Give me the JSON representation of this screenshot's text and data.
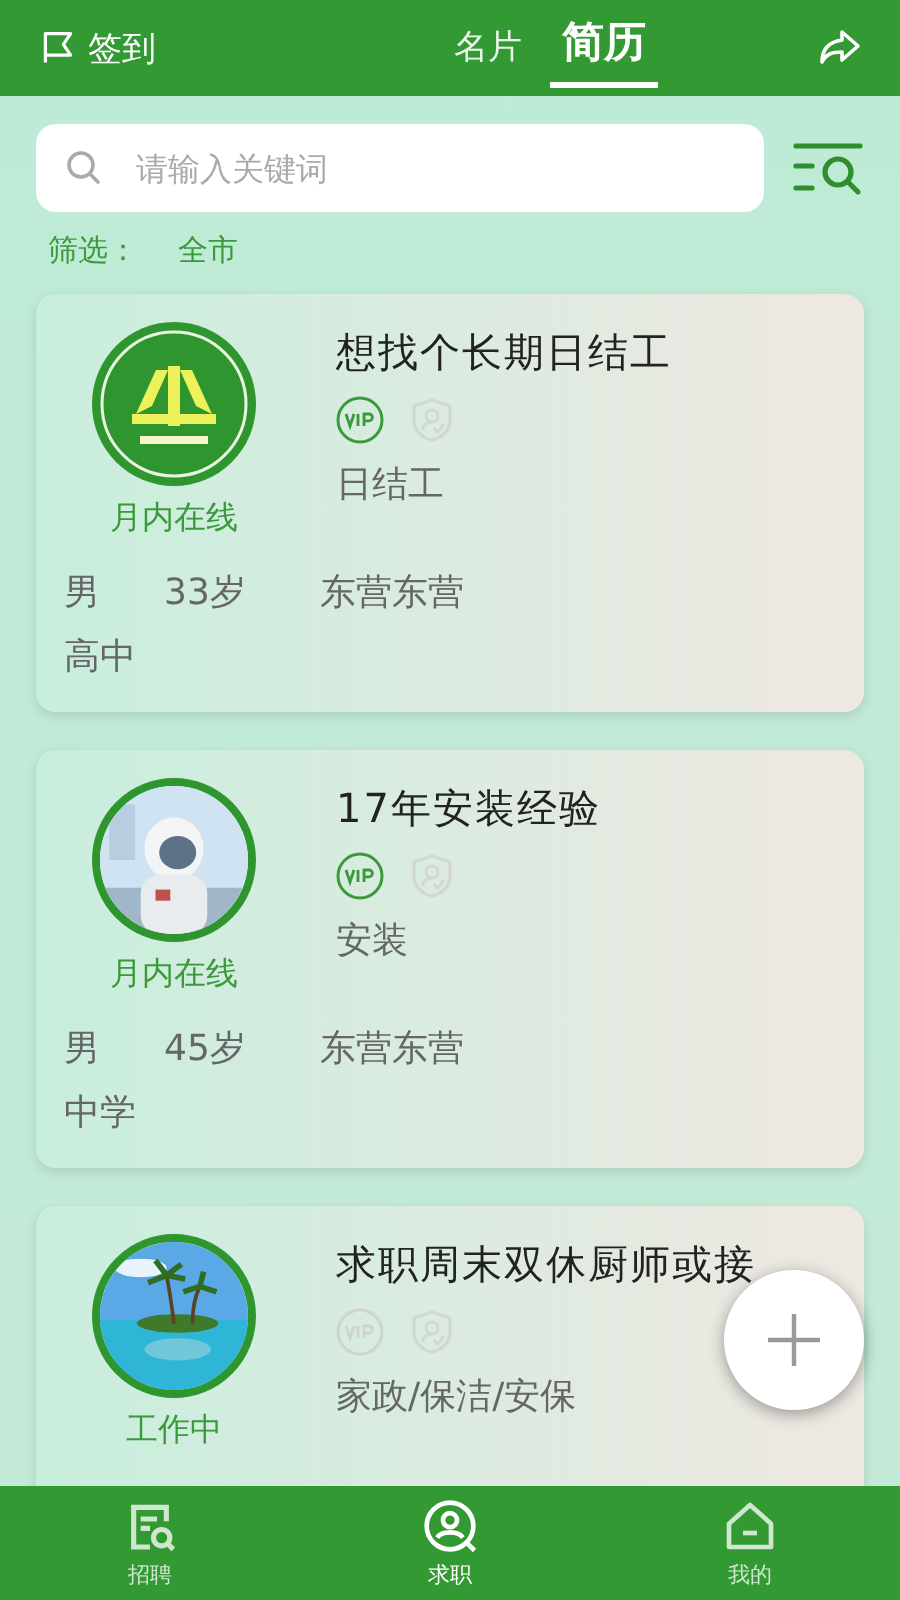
{
  "header": {
    "checkin": "签到",
    "tabs": [
      {
        "label": "名片",
        "selected": false
      },
      {
        "label": "简历",
        "selected": true
      }
    ]
  },
  "search": {
    "placeholder": "请输入关键词"
  },
  "filter": {
    "label": "筛选：",
    "value": "全市"
  },
  "resumes": [
    {
      "avatar": {
        "kind": "logo"
      },
      "status": "月内在线",
      "title": "想找个长期日结工",
      "vip": true,
      "verified": false,
      "category": "日结工",
      "gender": "男",
      "age": "33岁",
      "location": "东营东营",
      "education": "高中"
    },
    {
      "status": "月内在线",
      "title": "17年安装经验",
      "vip": true,
      "verified": false,
      "category": "安装",
      "gender": "男",
      "age": "45岁",
      "location": "东营东营",
      "education": "中学"
    },
    {
      "status": "工作中",
      "title": "求职周末双休厨师或接",
      "vip": false,
      "verified": false,
      "category": "家政/保洁/安保"
    }
  ],
  "nav": [
    {
      "label": "招聘",
      "kind": "doc",
      "selected": false
    },
    {
      "label": "求职",
      "kind": "user",
      "selected": true
    },
    {
      "label": "我的",
      "kind": "home",
      "selected": false
    }
  ]
}
